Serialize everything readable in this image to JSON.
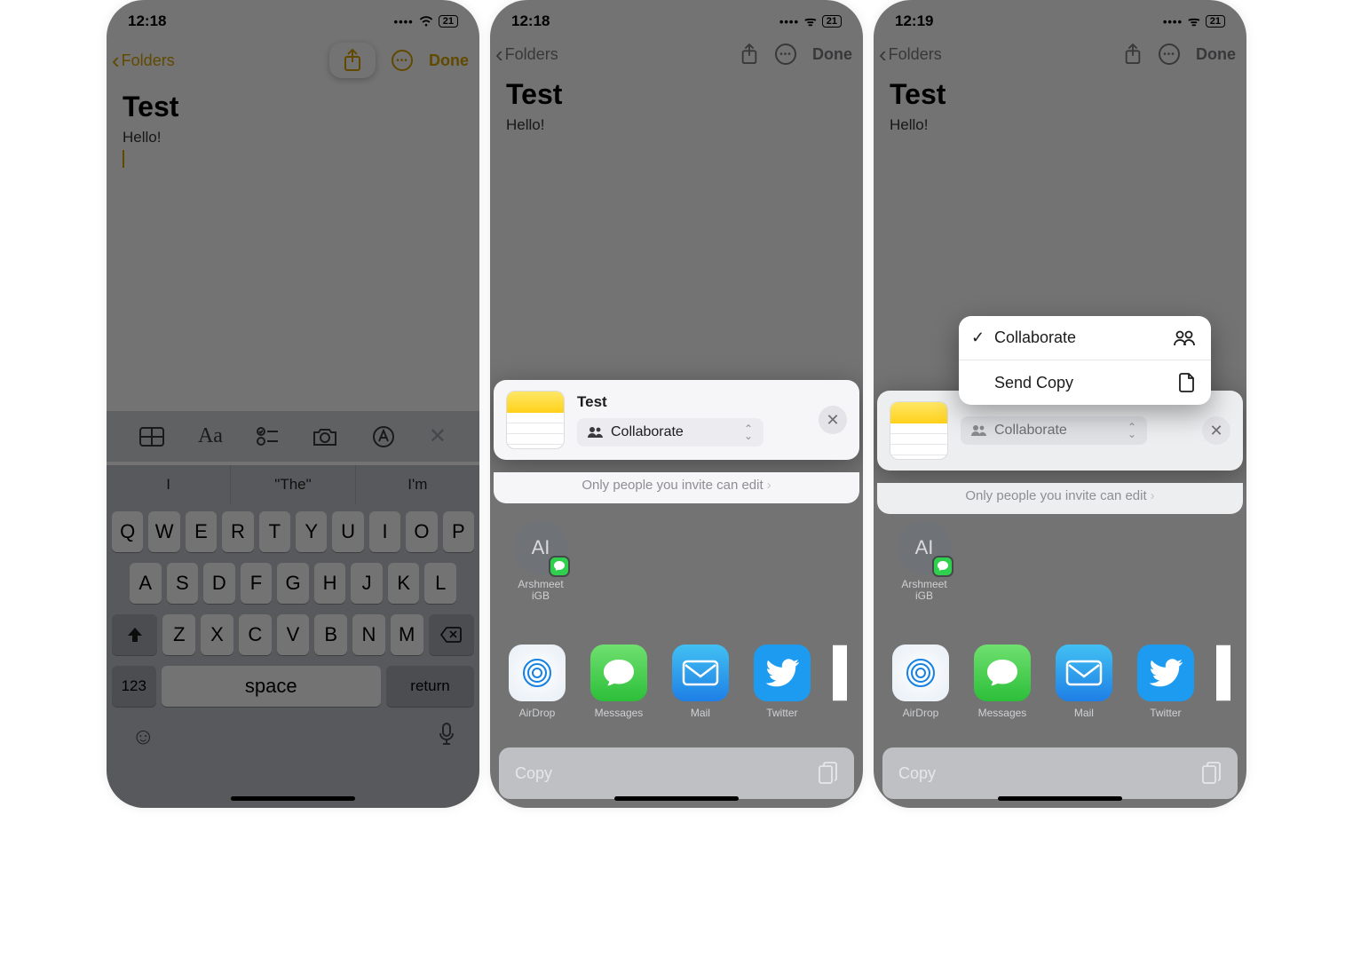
{
  "status": {
    "time1": "12:18",
    "time2": "12:18",
    "time3": "12:19",
    "battery": "21"
  },
  "nav": {
    "back": "Folders",
    "done": "Done"
  },
  "note": {
    "title": "Test",
    "body": "Hello!"
  },
  "suggestions": {
    "a": "I",
    "b": "The",
    "c": "I'm"
  },
  "keyboard": {
    "row1": [
      "Q",
      "W",
      "E",
      "R",
      "T",
      "Y",
      "U",
      "I",
      "O",
      "P"
    ],
    "row2": [
      "A",
      "S",
      "D",
      "F",
      "G",
      "H",
      "J",
      "K",
      "L"
    ],
    "row3": [
      "Z",
      "X",
      "C",
      "V",
      "B",
      "N",
      "M"
    ],
    "k123": "123",
    "space": "space",
    "return": "return"
  },
  "sheet": {
    "title": "Test",
    "collab": "Collaborate",
    "permission": "Only people you invite can edit"
  },
  "popup": {
    "opt1": "Collaborate",
    "opt2": "Send Copy"
  },
  "contact": {
    "initials": "AI",
    "name_l1": "Arshmeet",
    "name_l2": "iGB"
  },
  "apps": {
    "airdrop": "AirDrop",
    "messages": "Messages",
    "mail": "Mail",
    "twitter": "Twitter"
  },
  "action": {
    "copy": "Copy"
  }
}
